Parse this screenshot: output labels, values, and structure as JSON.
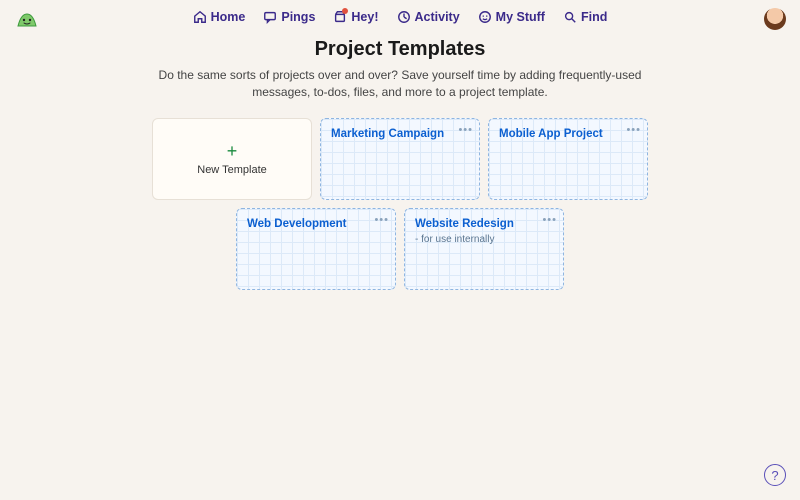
{
  "nav": {
    "home": "Home",
    "pings": "Pings",
    "hey": "Hey!",
    "activity": "Activity",
    "mystuff": "My Stuff",
    "find": "Find"
  },
  "page": {
    "title": "Project Templates",
    "subtitle": "Do the same sorts of projects over and over? Save yourself time by adding frequently-used messages, to-dos, files, and more to a project template."
  },
  "newTemplate": {
    "plus": "+",
    "label": "New Template"
  },
  "templates": [
    {
      "title": "Marketing Campaign",
      "desc": ""
    },
    {
      "title": "Mobile App Project",
      "desc": ""
    },
    {
      "title": "Web Development",
      "desc": ""
    },
    {
      "title": "Website Redesign",
      "desc": "- for use internally"
    }
  ],
  "moreGlyph": "•••",
  "helpGlyph": "?"
}
